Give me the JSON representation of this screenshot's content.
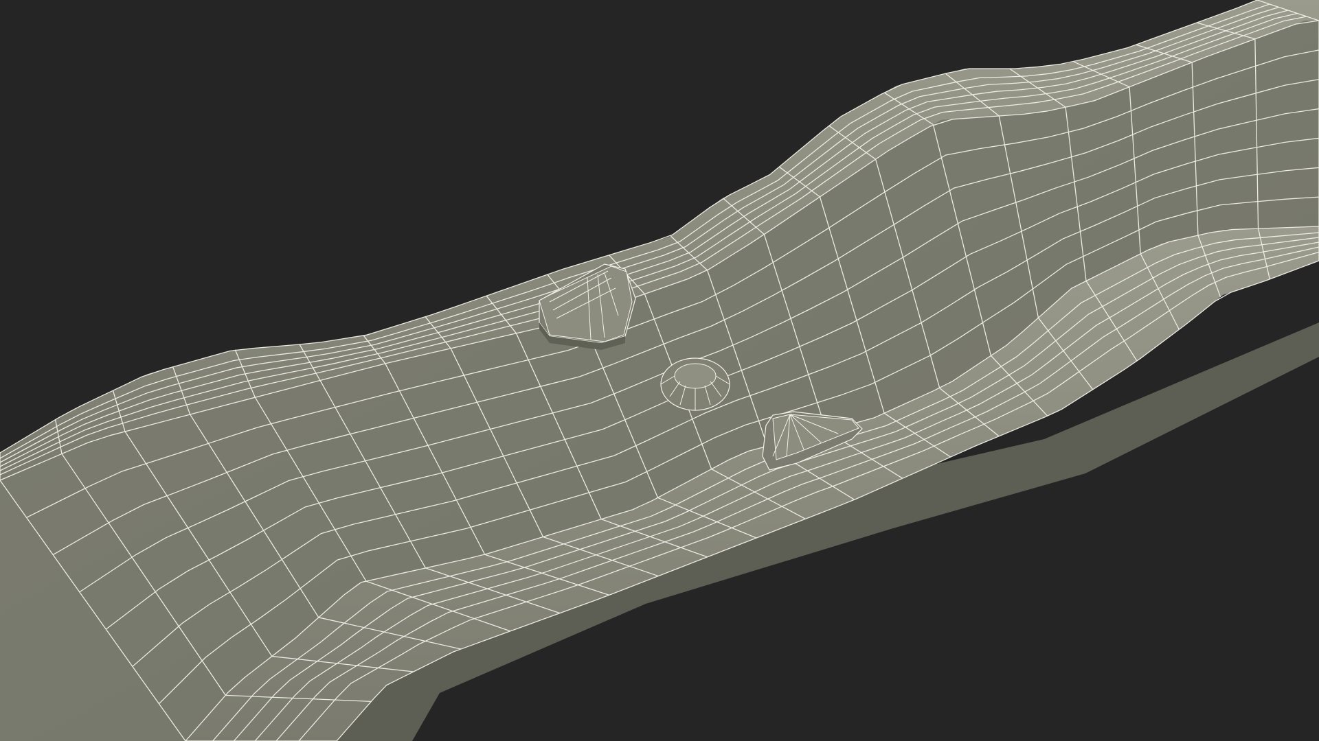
{
  "scene": {
    "subject": "wireframe-tray-model",
    "colors": {
      "background": "#252525",
      "floor": "#7a7b6e",
      "floor_shadow": "#64655a",
      "wall": "#8a8b7d",
      "wall_top": "#9a9b8c",
      "wall_inner": "#6c6d62",
      "edge": "#5d5e54",
      "wire": "#f2f2ea"
    },
    "icons": {
      "floor": "mesh-floor",
      "back_wall": "mesh-wall",
      "front_wall": "mesh-wall",
      "peg_left": "triangle-peg",
      "peg_center": "dome-peg",
      "peg_right": "triangle-peg"
    }
  }
}
